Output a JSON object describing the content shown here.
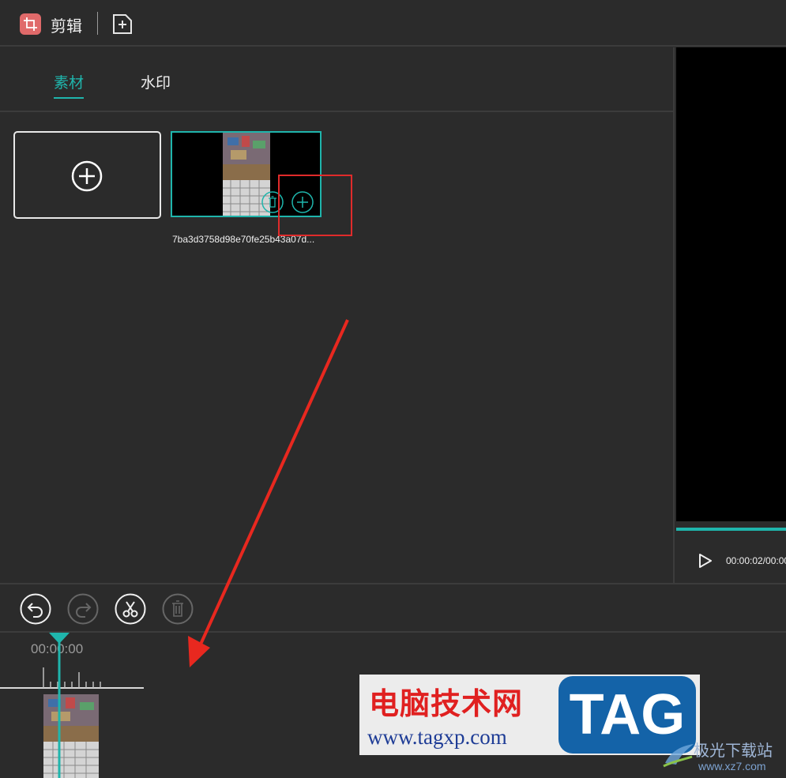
{
  "app": {
    "title": "剪辑",
    "icon": "crop-icon",
    "new_icon": "new-file-icon"
  },
  "tabs": [
    {
      "label": "素材",
      "active": true
    },
    {
      "label": "水印",
      "active": false
    }
  ],
  "media": {
    "add_icon": "plus-circle-icon",
    "clip": {
      "name": "7ba3d3758d98e70fe25b43a07d...",
      "delete_icon": "trash-icon",
      "add_icon": "plus-icon"
    }
  },
  "preview": {
    "time": "00:00:02/00:00",
    "play_icon": "play-icon"
  },
  "toolbar": {
    "undo": "undo-icon",
    "redo": "redo-icon",
    "cut": "scissors-icon",
    "delete": "trash-icon"
  },
  "timeline": {
    "timecode": "00:00:00"
  },
  "watermark": {
    "cn": "电脑技术网",
    "url": "www.tagxp.com",
    "tag": "TAG",
    "site2": "极光下载站",
    "site2_url": "www.xz7.com"
  },
  "colors": {
    "accent": "#1fb5ac",
    "highlight": "#e02b2b",
    "background": "#2b2b2b"
  }
}
